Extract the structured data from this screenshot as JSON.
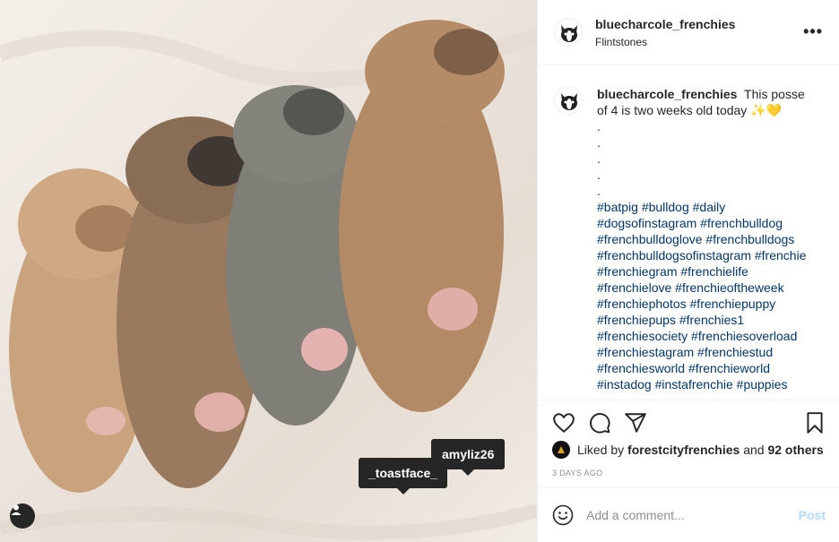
{
  "post": {
    "username": "bluecharcole_frenchies",
    "location": "Flintstones",
    "more_label": "•••",
    "caption_text": "This posse of 4 is two weeks old today ✨💛",
    "caption_dots": [
      ".",
      ".",
      ".",
      ".",
      "."
    ],
    "hashtags": [
      "#batpig #bulldog #daily",
      "#dogsofinstagram #frenchbulldog",
      "#frenchbulldoglove #frenchbulldogs",
      "#frenchbulldogsofinstagram #frenchie",
      "#frenchiegram #frenchielife",
      "#frenchielove #frenchieoftheweek",
      "#frenchiephotos #frenchiepuppy",
      "#frenchiepups #frenchies1",
      "#frenchiesociety #frenchiesoverload",
      "#frenchiestagram #frenchiestud",
      "#frenchiesworld #frenchieworld",
      "#instadog #instafrenchie #puppies"
    ],
    "likes": {
      "prefix": "Liked by",
      "user": "forestcityfrenchies",
      "connector": "and",
      "others": "92 others"
    },
    "timestamp": "3 DAYS AGO",
    "photo_tags": [
      "_toastface_",
      "amyliz26"
    ]
  },
  "comment": {
    "placeholder": "Add a comment...",
    "post_label": "Post"
  },
  "icons": {
    "more": "more-options-icon",
    "like": "heart-icon",
    "comment": "comment-icon",
    "share": "share-icon",
    "save": "bookmark-icon",
    "emoji": "emoji-icon",
    "user_tags": "user-tags-icon"
  },
  "colors": {
    "link": "#00376b",
    "post_disabled": "#b3dbff",
    "muted": "#8e8e8e",
    "text": "#262626"
  }
}
